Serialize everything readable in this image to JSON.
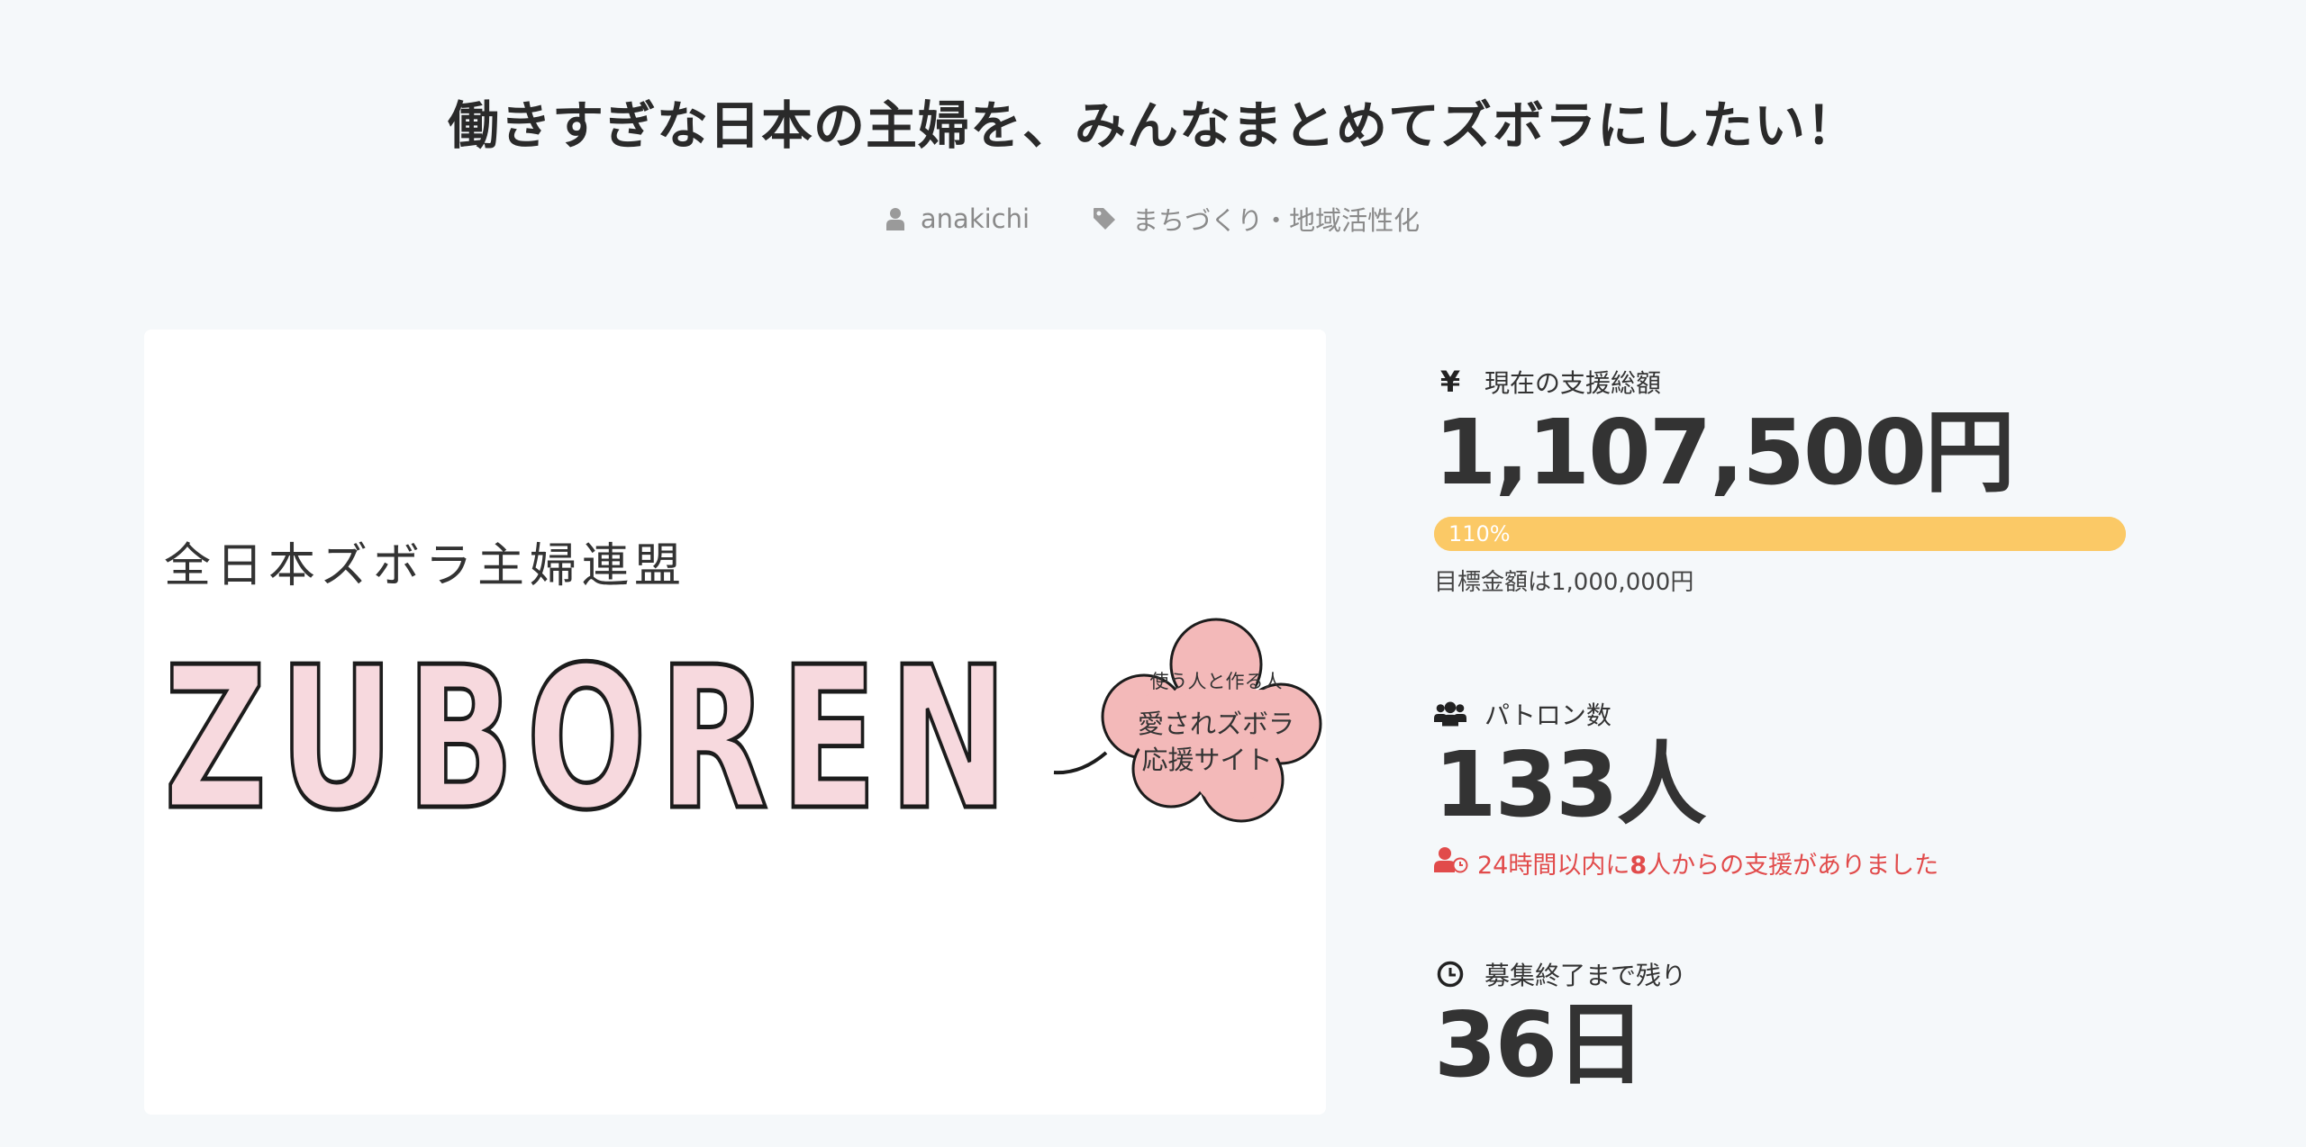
{
  "project": {
    "title": "働きすぎな日本の主婦を、みんなまとめてズボラにしたい！",
    "author": "anakichi",
    "category": "まちづくり・地域活性化"
  },
  "hero_image": {
    "org_name": "全日本ズボラ主婦連盟",
    "logo_text": "ZUBOREN",
    "bubble_line1": "使う人と作る人",
    "bubble_line2": "愛されズボラ",
    "bubble_line3": "応援サイト"
  },
  "stats": {
    "amount_label": "現在の支援総額",
    "amount_value": "1,107,500円",
    "progress_percent": 110,
    "progress_text": "110%",
    "goal_text": "目標金額は1,000,000円",
    "patrons_label": "パトロン数",
    "patrons_value": "133人",
    "recent_prefix": "24時間以内に",
    "recent_count": "8",
    "recent_suffix": "人からの支援がありました",
    "remaining_label": "募集終了まで残り",
    "remaining_value": "36日"
  },
  "icons": {
    "yen": "¥",
    "author": "user-icon",
    "category": "tag-icon",
    "patrons": "users-icon",
    "recent": "user-clock-icon",
    "remaining": "clock-icon"
  },
  "colors": {
    "progress": "#fbc966",
    "alert": "#e14b4b",
    "text": "#333333"
  }
}
